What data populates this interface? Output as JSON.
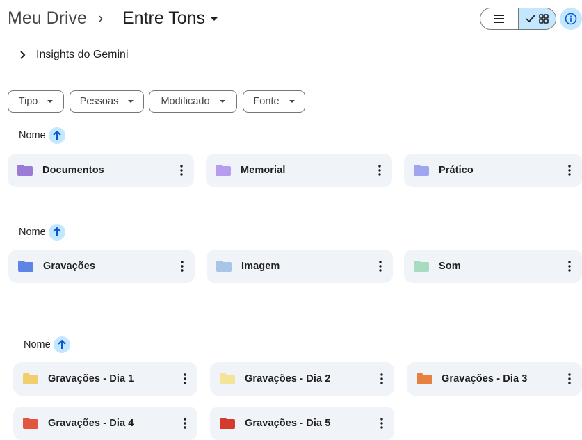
{
  "breadcrumb": {
    "root": "Meu Drive",
    "separator": "›",
    "current": "Entre Tons"
  },
  "insights": {
    "label": "Insights do Gemini"
  },
  "filters": [
    {
      "label": "Tipo"
    },
    {
      "label": "Pessoas"
    },
    {
      "label": "Modificado"
    },
    {
      "label": "Fonte"
    }
  ],
  "sections": [
    {
      "sort_label": "Nome",
      "folders": [
        {
          "name": "Documentos",
          "color": "#9c7ad8"
        },
        {
          "name": "Memorial",
          "color": "#b89cf0"
        },
        {
          "name": "Prático",
          "color": "#9fa6ef"
        }
      ]
    },
    {
      "sort_label": "Nome",
      "folders": [
        {
          "name": "Gravações",
          "color": "#5d84e6"
        },
        {
          "name": "Imagem",
          "color": "#a8c4e6"
        },
        {
          "name": "Som",
          "color": "#a8dcc0"
        }
      ]
    },
    {
      "sort_label": "Nome",
      "folders": [
        {
          "name": "Gravações - Dia 1",
          "color": "#f2cf6d"
        },
        {
          "name": "Gravações - Dia 2",
          "color": "#f6e39a"
        },
        {
          "name": "Gravações - Dia 3",
          "color": "#e8803f"
        },
        {
          "name": "Gravações - Dia 4",
          "color": "#e2553f"
        },
        {
          "name": "Gravações - Dia 5",
          "color": "#d33b2c"
        }
      ]
    }
  ],
  "colors": {
    "accent": "#c2e7ff",
    "card_bg": "#f0f4f9",
    "icon_dark": "#0b57d0"
  }
}
